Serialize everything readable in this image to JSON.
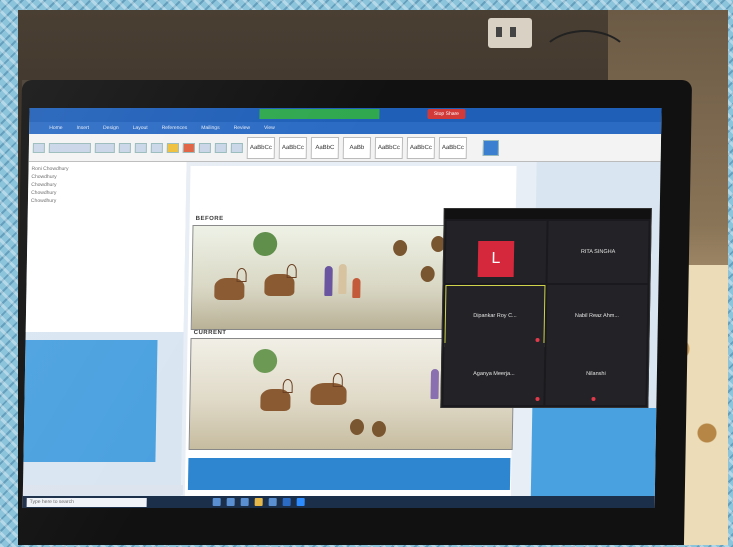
{
  "window": {
    "app_tabs": [
      "Home",
      "Insert",
      "Design",
      "Layout",
      "References",
      "Mailings",
      "Review",
      "View"
    ],
    "stop_share_label": "Stop Share"
  },
  "ribbon": {
    "styles": [
      "AaBbCc",
      "AaBbCc",
      "AaBbC",
      "AaBb",
      "AaBbCc",
      "AaBbCc",
      "AaBbCc"
    ]
  },
  "comments_pane": {
    "lines": [
      "Roni Chowdhury",
      "Chowdhury",
      "Chowdhury",
      "Chowdhury",
      "Chowdhury"
    ]
  },
  "document": {
    "panel_before_label": "BEFORE",
    "panel_current_label": "CURRENT"
  },
  "zoom": {
    "avatar_letter": "L",
    "participants": [
      "RITA SINGHA",
      "Dipankar Roy C...",
      "Nabil Reaz Ahm...",
      "Aganya Meerja...",
      "Nilanshi"
    ]
  },
  "taskbar": {
    "search_placeholder": "Type here to search"
  },
  "colors": {
    "zoom_avatar": "#d5283c",
    "stop_share": "#d23a3a",
    "meeting_bar": "#2fa84f",
    "word_blue": "#2b6bc4"
  }
}
